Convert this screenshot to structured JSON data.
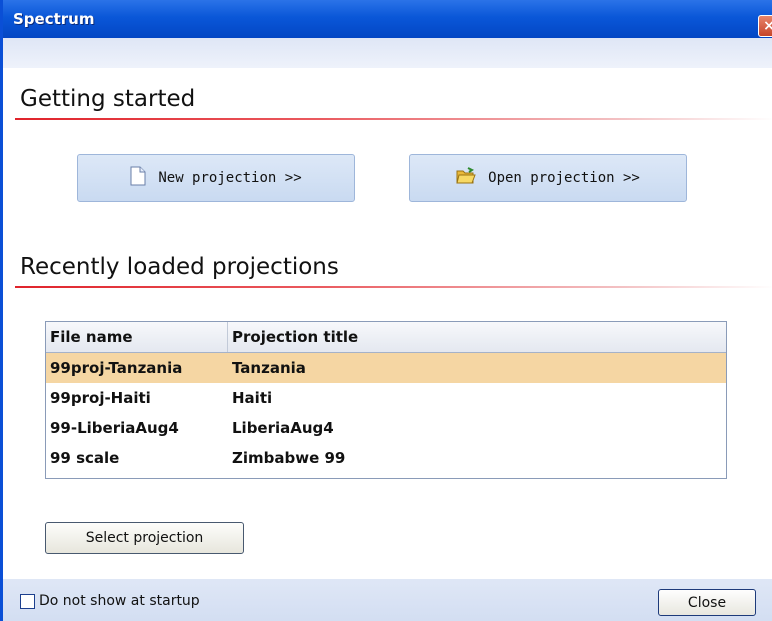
{
  "window": {
    "title": "Spectrum",
    "close_glyph": "×"
  },
  "getting_started": {
    "title": "Getting started",
    "new_projection": {
      "label": "New projection  >>",
      "icon": "new-document-icon"
    },
    "open_projection": {
      "label": "Open projection  >>",
      "icon": "open-folder-icon"
    }
  },
  "recent": {
    "title": "Recently loaded projections",
    "columns": [
      "File name",
      "Projection title"
    ],
    "rows": [
      {
        "file": "99proj-Tanzania",
        "title": "Tanzania",
        "selected": true
      },
      {
        "file": "99proj-Haiti",
        "title": "Haiti",
        "selected": false
      },
      {
        "file": "99-LiberiaAug4",
        "title": "LiberiaAug4",
        "selected": false
      },
      {
        "file": "99 scale",
        "title": "Zimbabwe 99",
        "selected": false
      }
    ],
    "select_button": "Select projection"
  },
  "footer": {
    "checkbox_label": "Do not show at startup",
    "checkbox_checked": false,
    "close_button": "Close"
  },
  "colors": {
    "titlebar": "#0a57d8",
    "accent_red": "#e0232b",
    "selected_row": "#f5d6a3",
    "button_bg": "#c9daf1"
  }
}
